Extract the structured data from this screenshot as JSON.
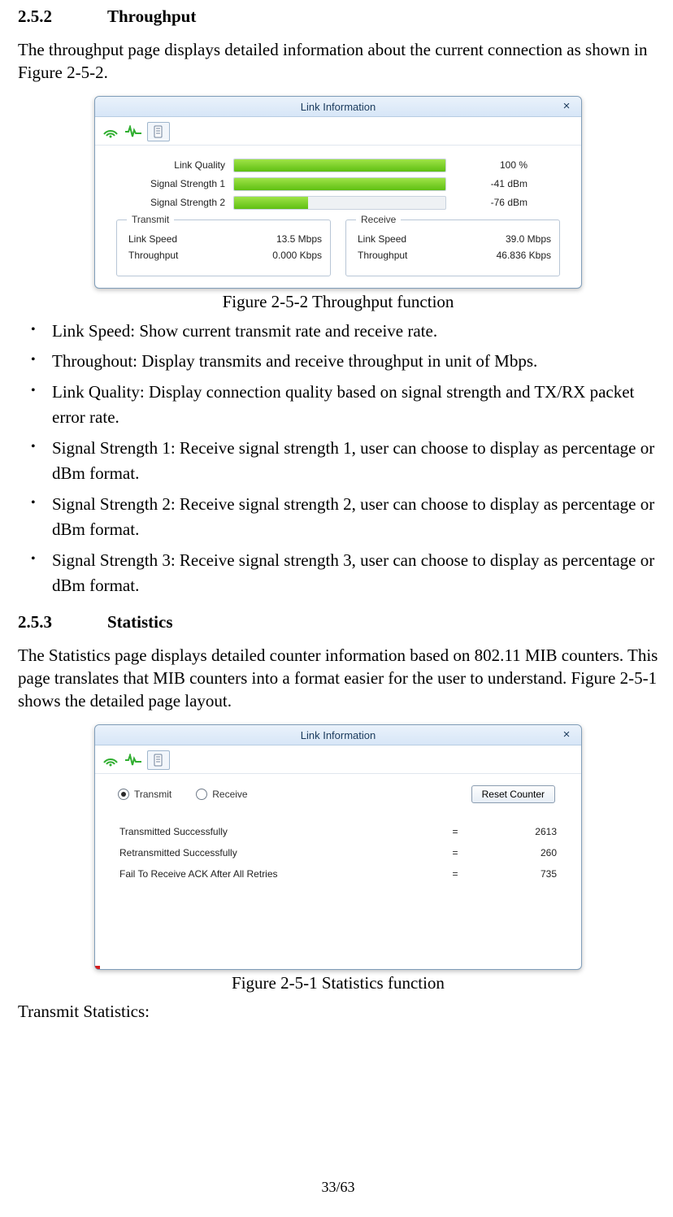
{
  "section1": {
    "num": "2.5.2",
    "title": "Throughput"
  },
  "p1": "The throughput page displays detailed information about the current connection as shown in Figure 2-5-2.",
  "fig1": {
    "title": "Link Information",
    "close": "×",
    "bars": [
      {
        "label": "Link Quality",
        "pct": 100,
        "val": "100 %"
      },
      {
        "label": "Signal Strength 1",
        "pct": 100,
        "val": "-41 dBm"
      },
      {
        "label": "Signal Strength 2",
        "pct": 35,
        "val": "-76 dBm"
      }
    ],
    "tx": {
      "legend": "Transmit",
      "rows": [
        {
          "k": "Link Speed",
          "v": "13.5 Mbps"
        },
        {
          "k": "Throughput",
          "v": "0.000 Kbps"
        }
      ]
    },
    "rx": {
      "legend": "Receive",
      "rows": [
        {
          "k": "Link Speed",
          "v": "39.0 Mbps"
        },
        {
          "k": "Throughput",
          "v": "46.836 Kbps"
        }
      ]
    }
  },
  "cap1": "Figure 2-5-2 Throughput function",
  "bullets1": [
    "Link Speed: Show current transmit rate and receive rate.",
    "Throughout: Display transmits and receive throughput in unit of Mbps.",
    "Link Quality: Display connection quality based on signal strength and TX/RX packet error rate.",
    "Signal Strength 1: Receive signal strength 1, user can choose to display as percentage or dBm format.",
    "Signal Strength 2: Receive signal strength 2, user can choose to display as percentage or dBm format.",
    "Signal Strength 3: Receive signal strength 3, user can choose to display as percentage or dBm format."
  ],
  "section2": {
    "num": "2.5.3",
    "title": "Statistics"
  },
  "p2": "The Statistics page displays detailed counter information based on 802.11 MIB counters. This page translates that MIB counters into a format easier for the user to understand. Figure 2-5-1 shows the detailed page layout.",
  "fig2": {
    "title": "Link Information",
    "close": "×",
    "radio_tx": "Transmit",
    "radio_rx": "Receive",
    "reset_btn": "Reset Counter",
    "rows": [
      {
        "k": "Transmitted Successfully",
        "v": "2613"
      },
      {
        "k": "Retransmitted Successfully",
        "v": "260"
      },
      {
        "k": "Fail To Receive ACK After All Retries",
        "v": "735"
      }
    ]
  },
  "cap2": "Figure 2-5-1 Statistics function",
  "p3": "Transmit Statistics:",
  "footer": "33/63"
}
